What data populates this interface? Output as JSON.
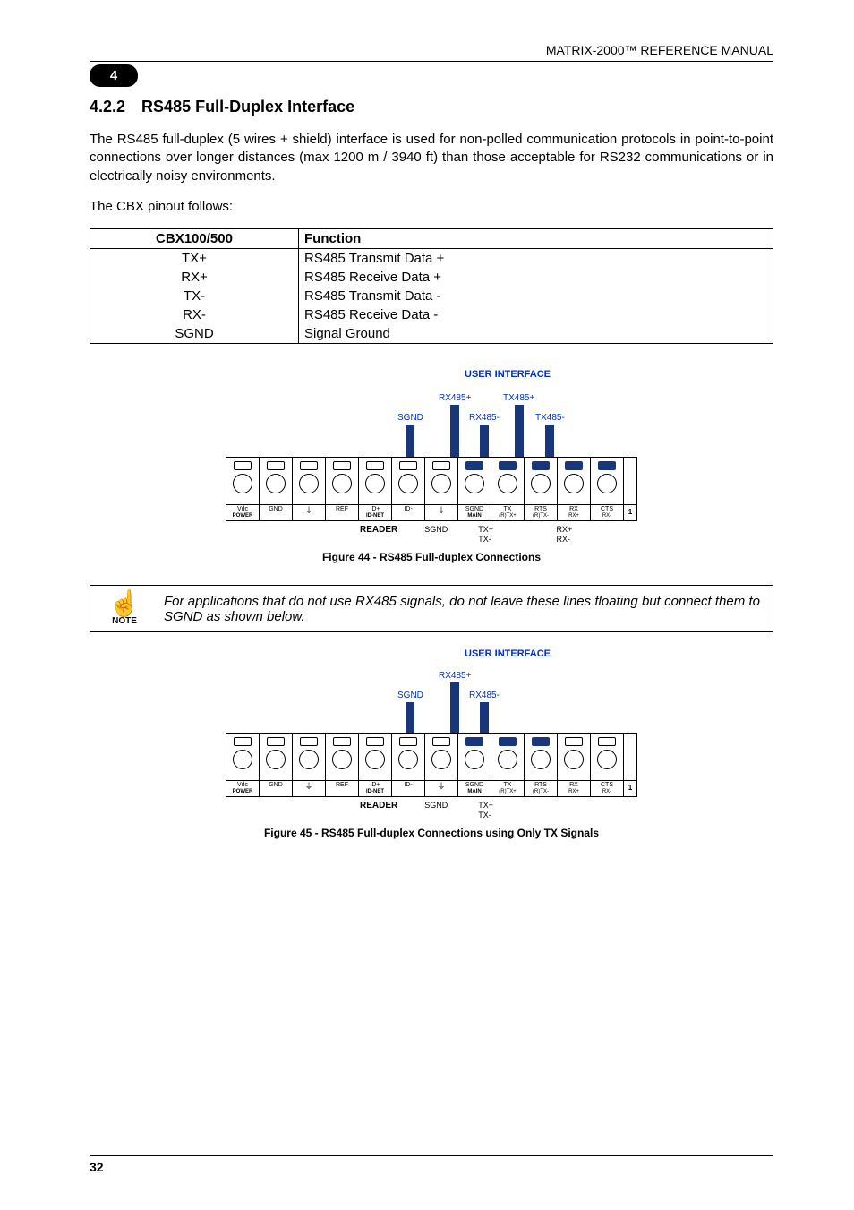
{
  "header": {
    "manual_title": "MATRIX-2000™ REFERENCE MANUAL",
    "chapter_pill": "4"
  },
  "section": {
    "number": "4.2.2",
    "title": "RS485 Full-Duplex Interface"
  },
  "paragraphs": {
    "p1": "The RS485 full-duplex (5 wires + shield) interface is used for non-polled communication protocols in point-to-point connections over longer distances (max 1200 m / 3940 ft) than those acceptable for RS232 communications or in electrically noisy environments.",
    "p2": "The CBX pinout follows:"
  },
  "pin_table": {
    "headers": [
      "CBX100/500",
      "Function"
    ],
    "rows": [
      [
        "TX+",
        "RS485 Transmit Data +"
      ],
      [
        "RX+",
        "RS485 Receive Data +"
      ],
      [
        "TX-",
        "RS485 Transmit Data -"
      ],
      [
        "RX-",
        "RS485 Receive Data -"
      ],
      [
        "SGND",
        "Signal Ground"
      ]
    ]
  },
  "figure44": {
    "caption": "Figure 44 - RS485 Full-duplex Connections",
    "user_interface": "USER INTERFACE",
    "wires_top": [
      "RX485+",
      "TX485+"
    ],
    "wires_bottom": [
      "SGND",
      "RX485-",
      "TX485-"
    ],
    "reader_label": "READER",
    "reader_cols": [
      {
        "top": "SGND",
        "bot": ""
      },
      {
        "top": "TX+",
        "bot": "TX-"
      },
      {
        "top": "",
        "bot": ""
      },
      {
        "top": "RX+",
        "bot": "RX-"
      }
    ],
    "term_labels": [
      "Vdc",
      "GND",
      "⏚",
      "REF",
      "ID+",
      "ID-",
      "⏚",
      "SGND",
      "TX",
      "RTS",
      "RX",
      "CTS",
      "1"
    ],
    "term_sub": [
      "POWER",
      "",
      "",
      "",
      "ID-NET",
      "",
      "",
      "MAIN",
      "(R)TX+",
      "(R)TX-",
      "RX+",
      "RX-",
      ""
    ]
  },
  "note": {
    "label": "NOTE",
    "text": "For applications that do not use RX485 signals, do not leave these lines floating but connect them to SGND as shown below."
  },
  "figure45": {
    "caption": "Figure 45 - RS485 Full-duplex Connections using Only TX Signals",
    "user_interface": "USER INTERFACE",
    "wires_top": [
      "RX485+"
    ],
    "wires_bottom": [
      "SGND",
      "RX485-"
    ],
    "reader_label": "READER",
    "reader_cols": [
      {
        "top": "SGND",
        "bot": ""
      },
      {
        "top": "TX+",
        "bot": "TX-"
      }
    ],
    "term_labels": [
      "Vdc",
      "GND",
      "⏚",
      "REF",
      "ID+",
      "ID-",
      "⏚",
      "SGND",
      "TX",
      "RTS",
      "RX",
      "CTS",
      "1"
    ],
    "term_sub": [
      "POWER",
      "",
      "",
      "",
      "ID-NET",
      "",
      "",
      "MAIN",
      "(R)TX+",
      "(R)TX-",
      "RX+",
      "RX-",
      ""
    ]
  },
  "footer": {
    "page": "32"
  }
}
